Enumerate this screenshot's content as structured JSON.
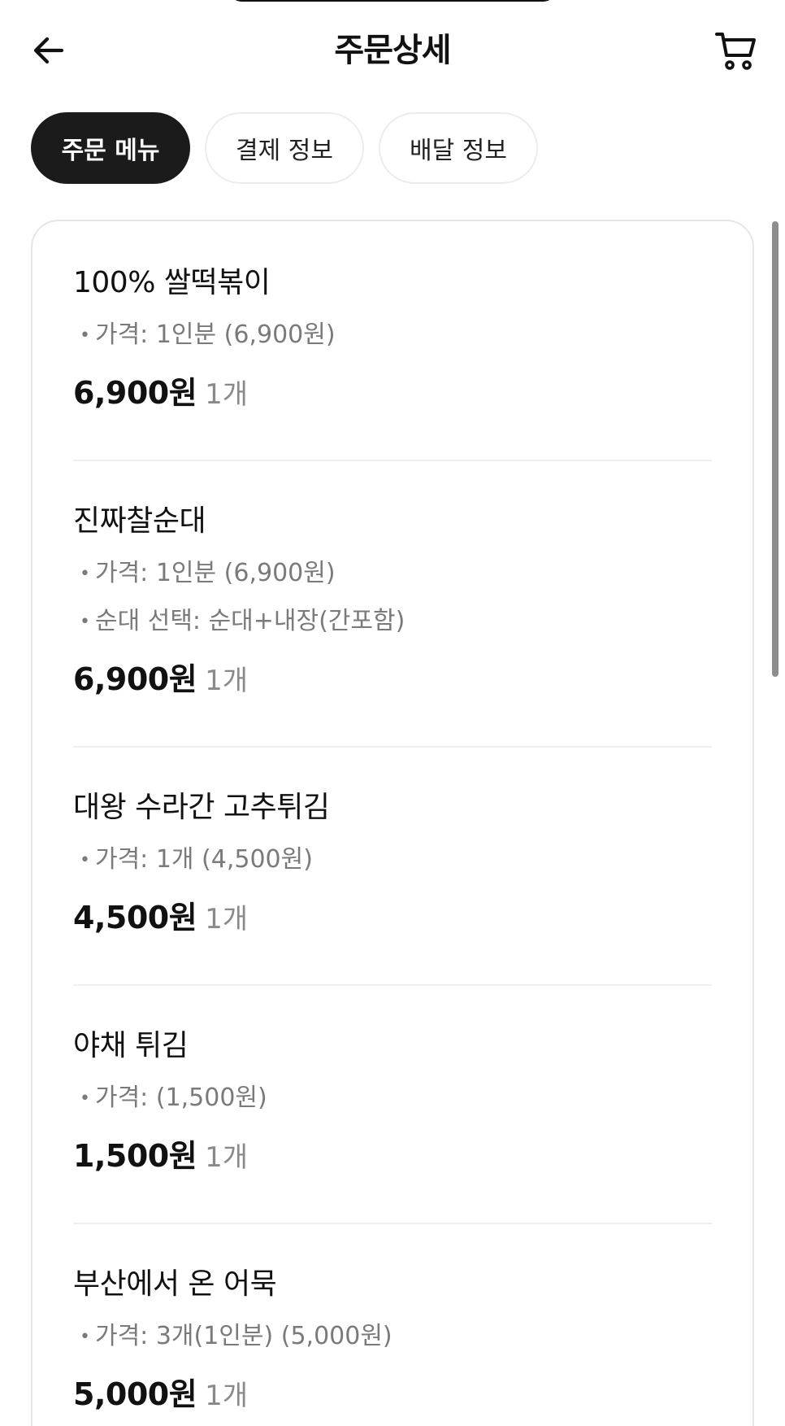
{
  "header": {
    "title": "주문상세"
  },
  "tabs": [
    {
      "label": "주문 메뉴",
      "active": true
    },
    {
      "label": "결제 정보",
      "active": false
    },
    {
      "label": "배달 정보",
      "active": false
    }
  ],
  "items": [
    {
      "name": "100% 쌀떡볶이",
      "options": [
        "가격: 1인분 (6,900원)"
      ],
      "price": "6,900원",
      "quantity": "1개"
    },
    {
      "name": "진짜찰순대",
      "options": [
        "가격: 1인분 (6,900원)",
        "순대 선택: 순대+내장(간포함)"
      ],
      "price": "6,900원",
      "quantity": "1개"
    },
    {
      "name": "대왕 수라간 고추튀김",
      "options": [
        "가격: 1개 (4,500원)"
      ],
      "price": "4,500원",
      "quantity": "1개"
    },
    {
      "name": "야채 튀김",
      "options": [
        "가격:  (1,500원)"
      ],
      "price": "1,500원",
      "quantity": "1개"
    },
    {
      "name": "부산에서 온 어묵",
      "options": [
        "가격: 3개(1인분) (5,000원)"
      ],
      "price": "5,000원",
      "quantity": "1개"
    }
  ],
  "icons": {
    "back": "arrow-left-icon",
    "cart": "cart-icon"
  },
  "colors": {
    "active_tab_bg": "#1b1b1b",
    "muted_text": "#7a7a7a"
  }
}
